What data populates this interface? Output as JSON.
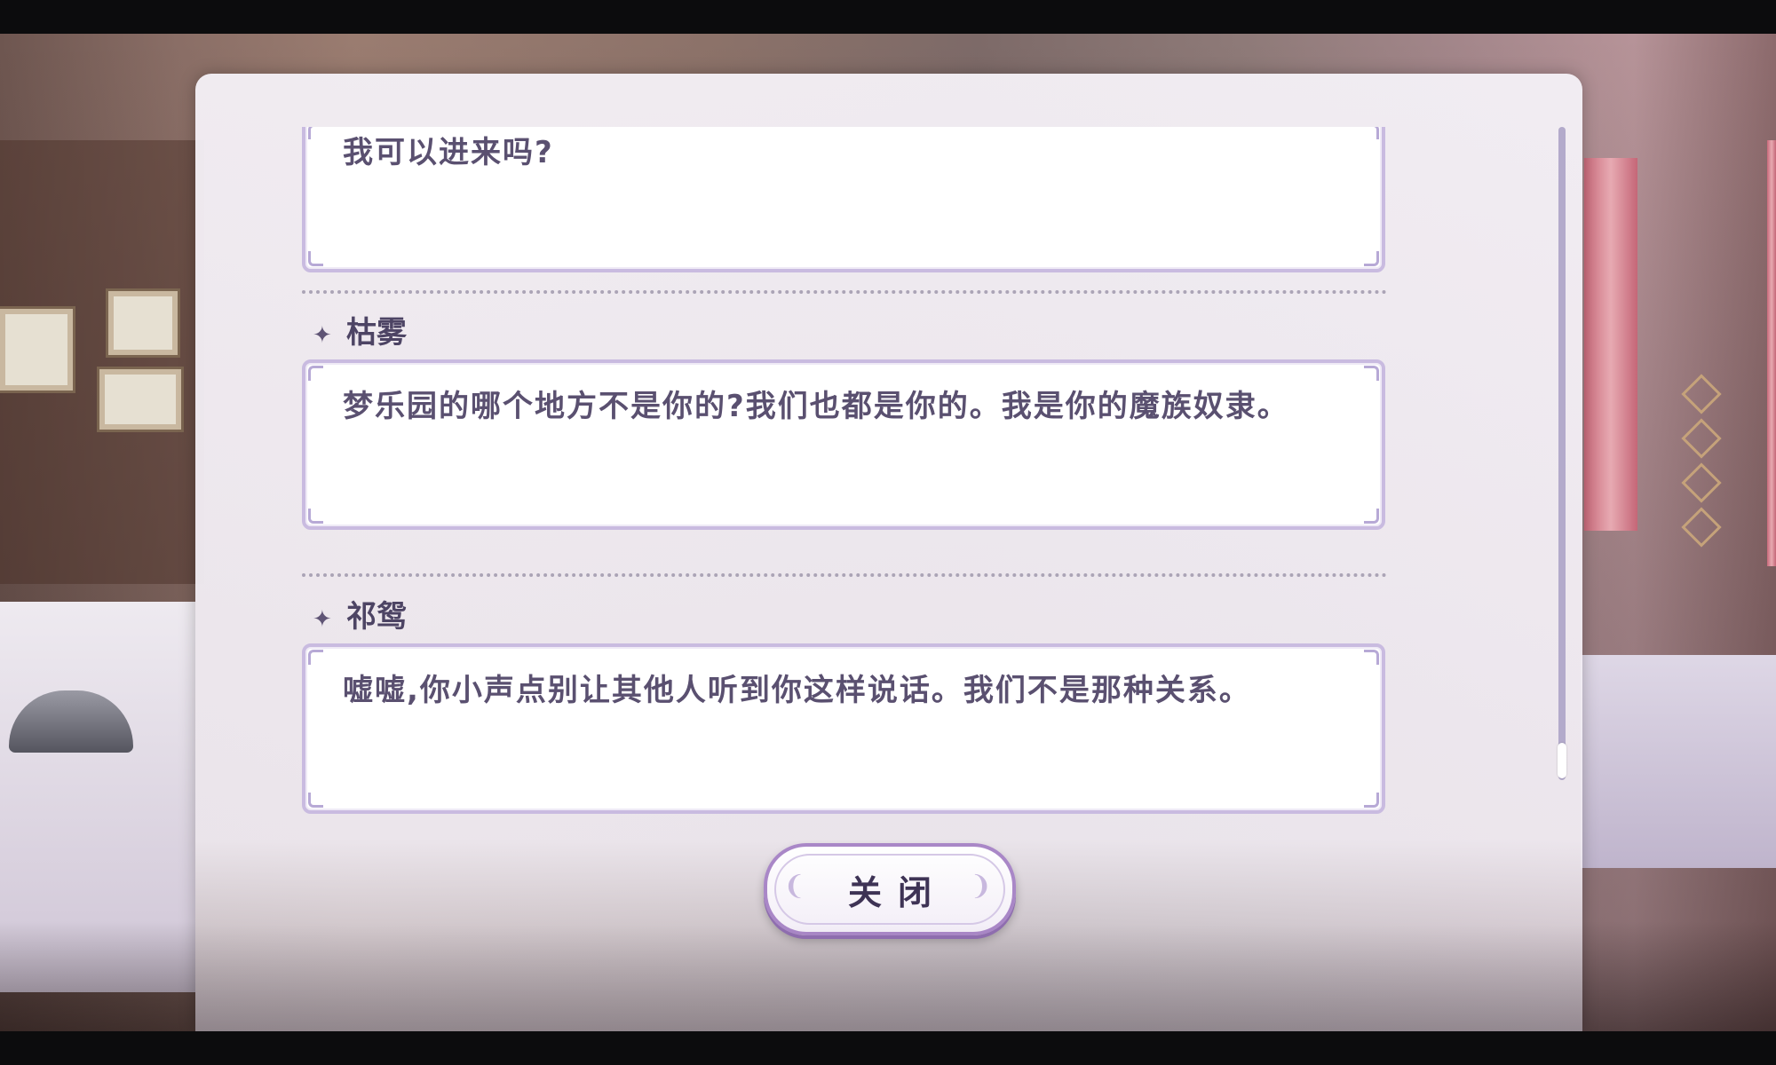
{
  "dialogue_log": {
    "entries": [
      {
        "speaker": "",
        "text": "我可以进来吗?"
      },
      {
        "speaker": "枯雾",
        "text": "梦乐园的哪个地方不是你的?我们也都是你的。我是你的魔族奴隶。"
      },
      {
        "speaker": "祁鸳",
        "text": "嘘嘘,你小声点别让其他人听到你这样说话。我们不是那种关系。"
      }
    ],
    "scroll_position": 0.95
  },
  "close_button": {
    "label": "关闭"
  },
  "icons": {
    "speaker_marker": "star-icon"
  }
}
